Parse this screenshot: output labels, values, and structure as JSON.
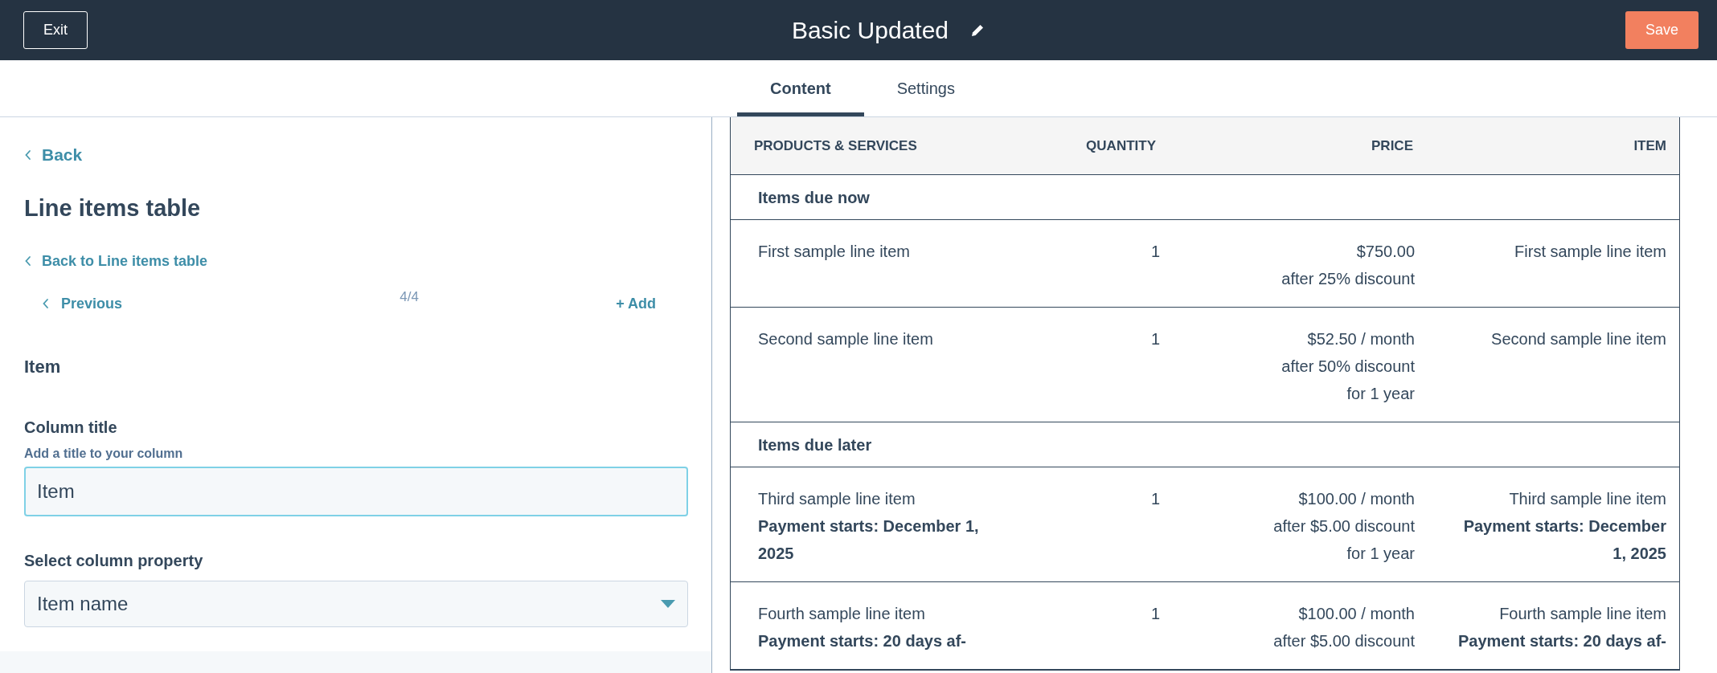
{
  "header": {
    "exit_button": "Exit",
    "title": "Basic Updated",
    "save_button": "Save"
  },
  "tabs": [
    {
      "label": "Content",
      "selected": true
    },
    {
      "label": "Settings",
      "selected": false
    }
  ],
  "sidebar": {
    "back_link": "Back",
    "heading": "Line items table",
    "back_to_link": "Back to Line items table",
    "previous_link": "Previous",
    "pager": "4/4",
    "add_link": "+ Add",
    "section_title": "Item",
    "column_title": {
      "label": "Column title",
      "hint": "Add a title to your column",
      "value": "Item"
    },
    "column_property": {
      "label": "Select column property",
      "value": "Item name"
    }
  },
  "table": {
    "columns": [
      "PRODUCTS & SERVICES",
      "QUANTITY",
      "PRICE",
      "ITEM"
    ],
    "rows": [
      {
        "kind": "section",
        "title": "Items due now"
      },
      {
        "kind": "item",
        "product": {
          "name": "First sample line item"
        },
        "quantity": "1",
        "price": [
          "$750.00",
          "after 25% discount"
        ],
        "item": {
          "name": "First sample line item"
        }
      },
      {
        "kind": "item",
        "product": {
          "name": "Second sample line item"
        },
        "quantity": "1",
        "price": [
          "$52.50 / month",
          "after 50% discount",
          "for 1 year"
        ],
        "item": {
          "name": "Second sample line item"
        }
      },
      {
        "kind": "section",
        "title": "Items due later"
      },
      {
        "kind": "item",
        "product": {
          "name": "Third sample line item",
          "note": "Payment starts: December 1, 2025"
        },
        "quantity": "1",
        "price": [
          "$100.00 / month",
          "after $5.00 discount",
          "for 1 year"
        ],
        "item": {
          "name": "Third sample line item",
          "note": "Payment starts: December 1, 2025"
        }
      },
      {
        "kind": "item",
        "product": {
          "name": "Fourth sample line item",
          "note": "Payment starts: 20 days af-"
        },
        "quantity": "1",
        "price": [
          "$100.00 / month",
          "after $5.00 discount"
        ],
        "item": {
          "name": "Fourth sample line item",
          "note": "Payment starts: 20 days af-"
        }
      }
    ]
  }
}
